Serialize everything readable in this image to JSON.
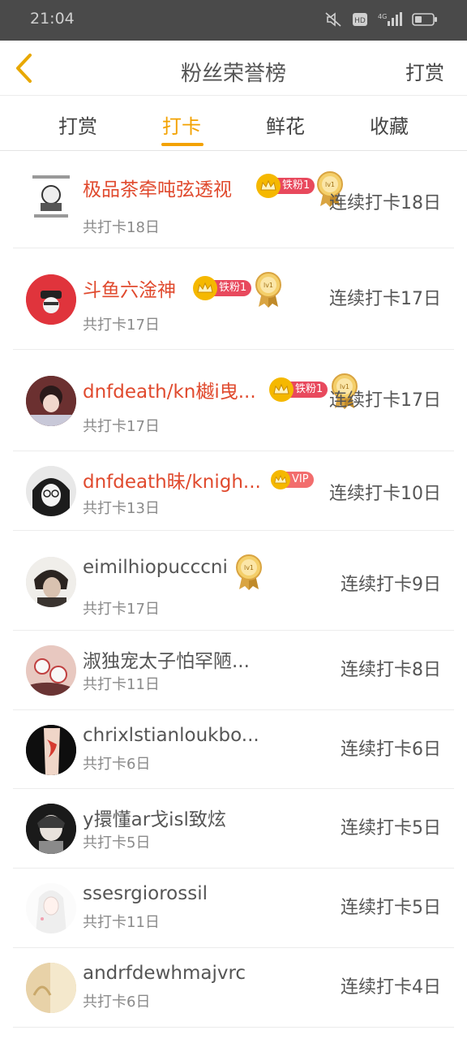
{
  "status_bar": {
    "time": "21:04",
    "icons": [
      "mute-icon",
      "hd-icon",
      "signal-4g-icon",
      "battery-icon"
    ]
  },
  "header": {
    "title": "粉丝荣誉榜",
    "action_label": "打赏"
  },
  "tabs": [
    {
      "label": "打赏",
      "active": false
    },
    {
      "label": "打卡",
      "active": true
    },
    {
      "label": "鲜花",
      "active": false
    },
    {
      "label": "收藏",
      "active": false
    }
  ],
  "colors": {
    "accent": "#f3a200",
    "vip_name": "#e04a2e",
    "fan_badge": "#e8495d",
    "crown": "#f5b800"
  },
  "rows": [
    {
      "name": "极品茶牵吨弦透视",
      "sub": "共打卡18日",
      "streak": "连续打卡18日",
      "badge": "铁粉1",
      "medal": "lv1"
    },
    {
      "name": "斗鱼六淦神",
      "sub": "共打卡17日",
      "streak": "连续打卡17日",
      "badge": "铁粉1",
      "medal": "lv1"
    },
    {
      "name": "dnfdeath/kn樾i曳...",
      "sub": "共打卡17日",
      "streak": "连续打卡17日",
      "badge": "铁粉1",
      "medal": "lv1"
    },
    {
      "name": "dnfdeath昧/knigh...",
      "sub": "共打卡13日",
      "streak": "连续打卡10日",
      "badge": "VIP"
    },
    {
      "name": "eimilhiopucccni",
      "sub": "共打卡17日",
      "streak": "连续打卡9日",
      "medal": "lv1"
    },
    {
      "name": "淑独宠太子怕罕陋...",
      "sub": "共打卡11日",
      "streak": "连续打卡8日"
    },
    {
      "name": "chrixlstianloukbo...",
      "sub": "共打卡6日",
      "streak": "连续打卡6日"
    },
    {
      "name": "y擐懂ar戈isl致炫",
      "sub": "共打卡5日",
      "streak": "连续打卡5日"
    },
    {
      "name": "ssesrgiorossil",
      "sub": "共打卡11日",
      "streak": "连续打卡5日"
    },
    {
      "name": "andrfdewhmajvrc",
      "sub": "共打卡6日",
      "streak": "连续打卡4日"
    }
  ]
}
